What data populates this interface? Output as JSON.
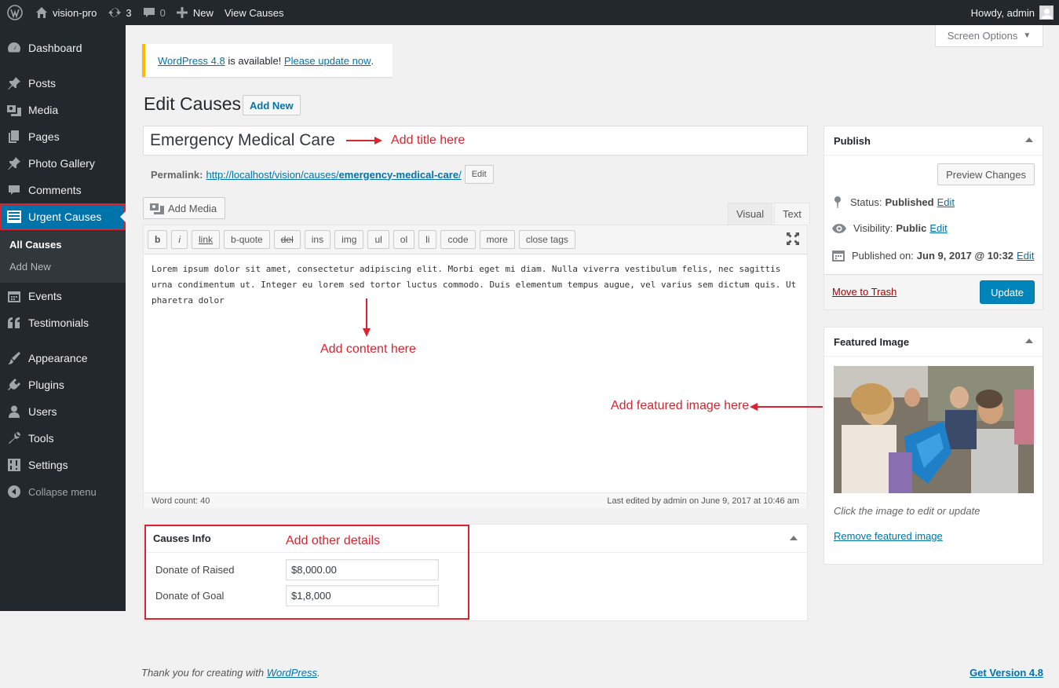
{
  "adminbar": {
    "site_name": "vision-pro",
    "updates_count": "3",
    "comments_count": "0",
    "new_label": "New",
    "view_label": "View Causes",
    "howdy": "Howdy, admin"
  },
  "sidebar": {
    "items": [
      {
        "label": "Dashboard",
        "icon": "dashboard-icon"
      },
      {
        "label": "Posts",
        "icon": "pin-icon"
      },
      {
        "label": "Media",
        "icon": "media-icon"
      },
      {
        "label": "Pages",
        "icon": "pages-icon"
      },
      {
        "label": "Photo Gallery",
        "icon": "pin-icon"
      },
      {
        "label": "Comments",
        "icon": "comment-icon"
      },
      {
        "label": "Urgent Causes",
        "icon": "list-icon"
      },
      {
        "label": "Events",
        "icon": "calendar-icon"
      },
      {
        "label": "Testimonials",
        "icon": "quote-icon"
      },
      {
        "label": "Appearance",
        "icon": "brush-icon"
      },
      {
        "label": "Plugins",
        "icon": "plugin-icon"
      },
      {
        "label": "Users",
        "icon": "user-icon"
      },
      {
        "label": "Tools",
        "icon": "wrench-icon"
      },
      {
        "label": "Settings",
        "icon": "settings-icon"
      },
      {
        "label": "Collapse menu",
        "icon": "collapse-icon"
      }
    ],
    "submenu": [
      "All Causes",
      "Add New"
    ]
  },
  "screen_options": "Screen Options",
  "notice": {
    "link1": "WordPress 4.8",
    "text": " is available! ",
    "link2": "Please update now",
    "end": "."
  },
  "page_title": "Edit Causes",
  "add_new": "Add New",
  "post_title": "Emergency Medical Care",
  "permalink": {
    "label": "Permalink:",
    "url_base": "http://localhost/vision/causes/",
    "slug": "emergency-medical-care",
    "end": "/",
    "edit": "Edit"
  },
  "editor": {
    "add_media": "Add Media",
    "tab_visual": "Visual",
    "tab_text": "Text",
    "quicktags": [
      "b",
      "i",
      "link",
      "b-quote",
      "del",
      "ins",
      "img",
      "ul",
      "ol",
      "li",
      "code",
      "more",
      "close tags"
    ],
    "content": "Lorem ipsum dolor sit amet, consectetur adipiscing elit. Morbi eget mi diam. Nulla viverra vestibulum felis, nec sagittis urna condimentum ut. Integer eu lorem sed tortor luctus commodo. Duis elementum tempus augue, vel varius sem dictum quis. Ut pharetra dolor",
    "word_count": "Word count: 40",
    "last_edited": "Last edited by admin on June 9, 2017 at 10:46 am"
  },
  "causes_info": {
    "title": "Causes Info",
    "raised_label": "Donate of Raised",
    "raised_value": "$8,000.00",
    "goal_label": "Donate of Goal",
    "goal_value": "$1,8,000"
  },
  "publish": {
    "title": "Publish",
    "preview": "Preview Changes",
    "status_label": "Status:",
    "status_value": "Published",
    "visibility_label": "Visibility:",
    "visibility_value": "Public",
    "published_label": "Published on:",
    "published_value": "Jun 9, 2017 @ 10:32",
    "edit": "Edit",
    "trash": "Move to Trash",
    "update": "Update"
  },
  "featured": {
    "title": "Featured Image",
    "caption": "Click the image to edit or update",
    "remove": "Remove featured image"
  },
  "annotations": {
    "title": "Add title here",
    "content": "Add content here",
    "featured": "Add featured image here",
    "details": "Add other details"
  },
  "footer": {
    "prefix": "Thank you for creating with ",
    "link": "WordPress",
    "suffix": ".",
    "version": "Get Version 4.8"
  },
  "colors": {
    "adminbar": "#23282d",
    "accent": "#0073aa",
    "annotation": "#d9242f",
    "notice": "#ffb900"
  }
}
